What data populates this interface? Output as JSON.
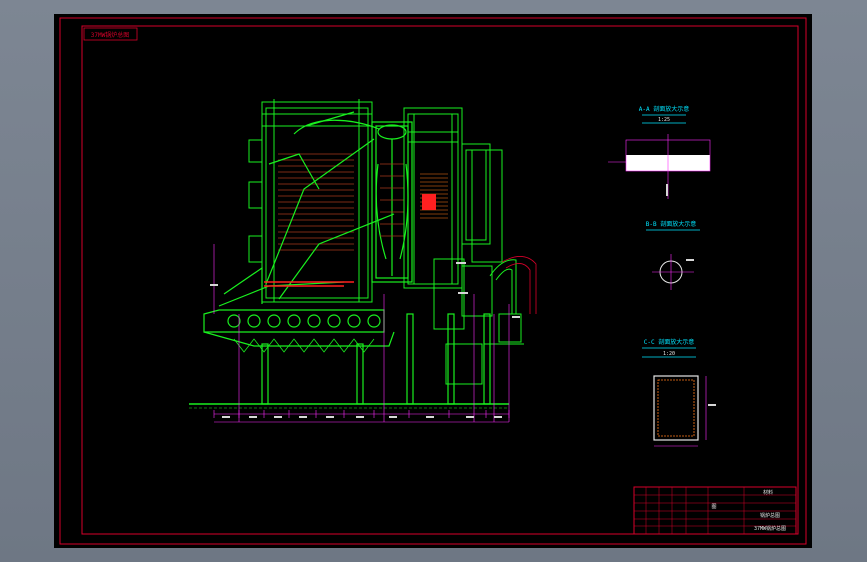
{
  "colors": {
    "background": "#000000",
    "frame": "#d6002a",
    "boiler": "#19f01f",
    "dimension": "#ff2cff",
    "detail": "#e6e6e6",
    "accent_red": "#ff2020",
    "annotation": "#00e5ff",
    "cad_window": "#6f7885"
  },
  "drawing": {
    "corner_stamp": "37MW锅炉总图",
    "section_a_title": "A-A 剖面放大示意",
    "section_a_scale": "1:25",
    "section_b_title": "B-B 剖面放大示意",
    "section_c_title": "C-C 剖面放大示意",
    "section_c_scale": "1:20"
  },
  "title_block": {
    "drawing_name": "37MW锅炉总图",
    "project_name": "锅炉总图",
    "sheet_label": "图",
    "material_label": "材料"
  }
}
